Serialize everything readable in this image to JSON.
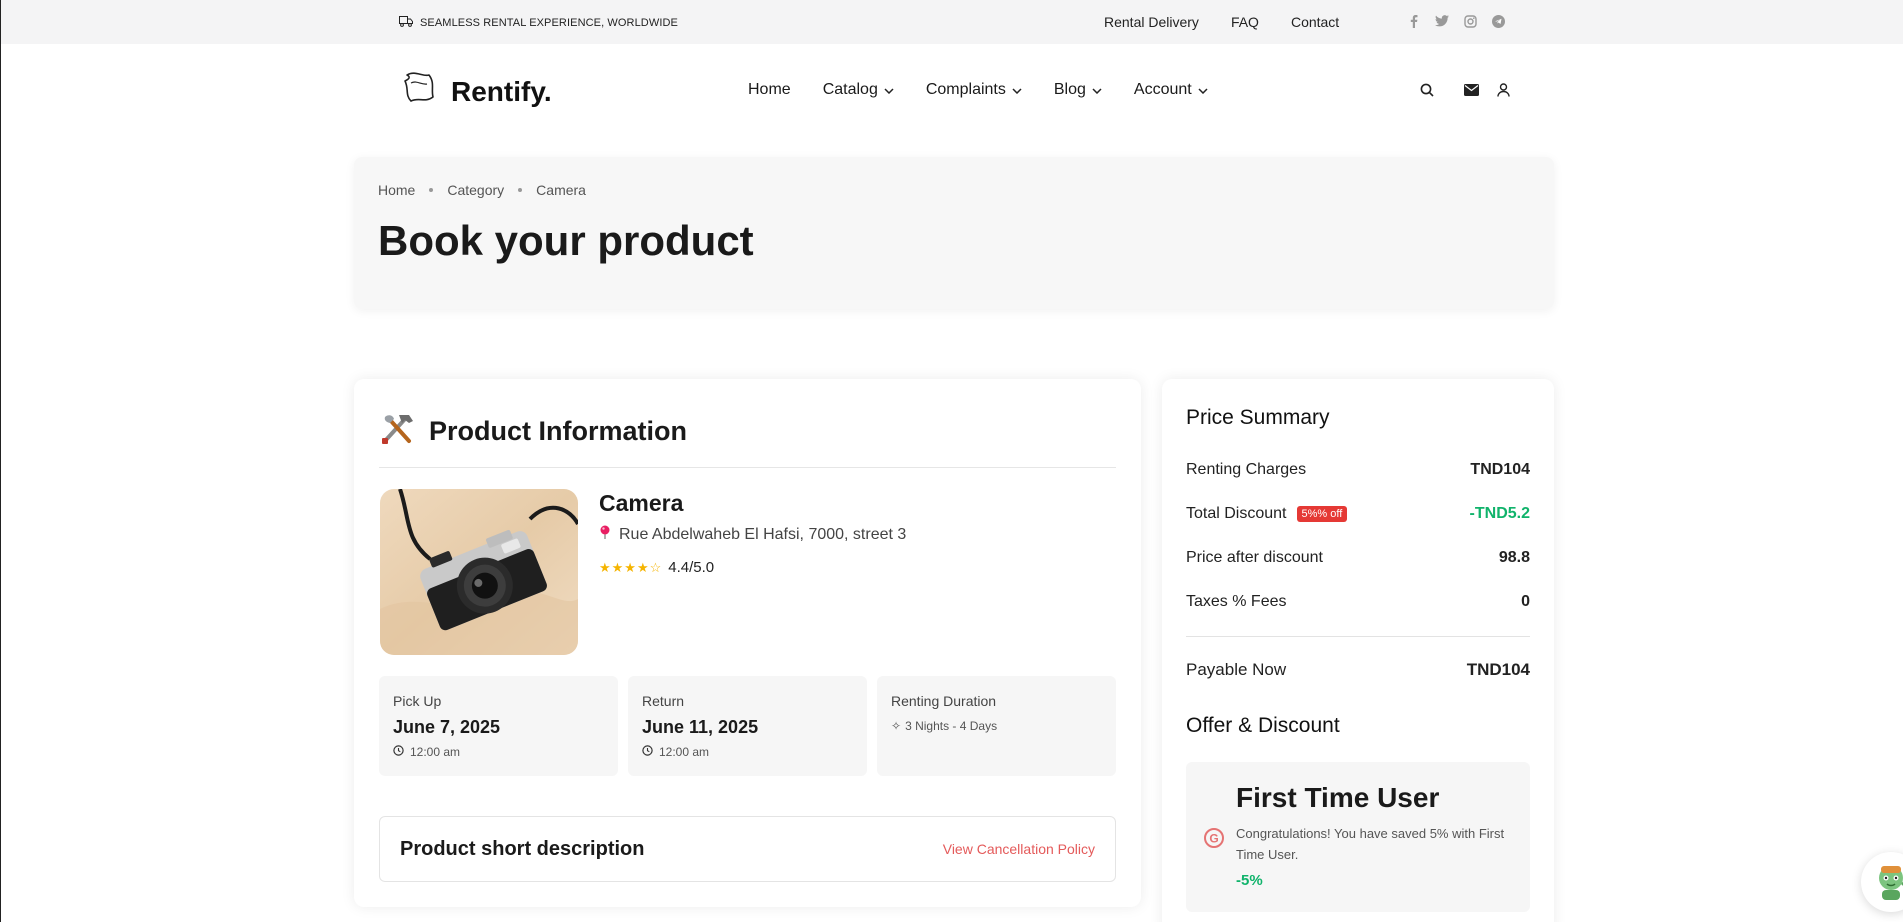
{
  "topbar": {
    "tagline": "SEAMLESS RENTAL EXPERIENCE, WORLDWIDE",
    "links": [
      "Rental Delivery",
      "FAQ",
      "Contact"
    ],
    "social_icons": [
      "facebook-icon",
      "twitter-icon",
      "instagram-icon",
      "telegram-icon"
    ]
  },
  "header": {
    "brand": "Rentify.",
    "nav": [
      {
        "label": "Home",
        "dropdown": false
      },
      {
        "label": "Catalog",
        "dropdown": true
      },
      {
        "label": "Complaints",
        "dropdown": true
      },
      {
        "label": "Blog",
        "dropdown": true
      },
      {
        "label": "Account",
        "dropdown": true
      }
    ],
    "icons": [
      "search-icon",
      "mail-icon",
      "user-icon"
    ]
  },
  "banner": {
    "breadcrumb": [
      "Home",
      "Category",
      "Camera"
    ],
    "title": "Book your product"
  },
  "product_info": {
    "heading": "Product Information",
    "name": "Camera",
    "address": "Rue Abdelwaheb El Hafsi, 7000, street 3",
    "rating_text": "4.4/5.0",
    "rating": 4.4,
    "pickup": {
      "label": "Pick Up",
      "date": "June 7, 2025",
      "time": "12:00 am"
    },
    "return": {
      "label": "Return",
      "date": "June 11, 2025",
      "time": "12:00 am"
    },
    "duration": {
      "label": "Renting Duration",
      "value": "3 Nights - 4 Days"
    },
    "description_title": "Product short description",
    "cancellation_link": "View Cancellation Policy"
  },
  "price_summary": {
    "heading": "Price Summary",
    "rows": [
      {
        "label": "Renting Charges",
        "value": "TND104"
      },
      {
        "label": "Total Discount",
        "badge": "5%% off",
        "value": "-TND5.2"
      },
      {
        "label": "Price after discount",
        "value": "98.8"
      },
      {
        "label": "Taxes % Fees",
        "value": "0"
      }
    ],
    "payable_label": "Payable Now",
    "payable_value": "TND104",
    "offer_heading": "Offer & Discount",
    "offer": {
      "title": "First Time User",
      "desc": "Congratulations! You have saved 5% with First Time User.",
      "value": "-5%"
    }
  },
  "chat_widget": {
    "count": "1"
  },
  "colors": {
    "accent_red": "#e53935",
    "green": "#10b36b",
    "link_red": "#e45a5a"
  }
}
